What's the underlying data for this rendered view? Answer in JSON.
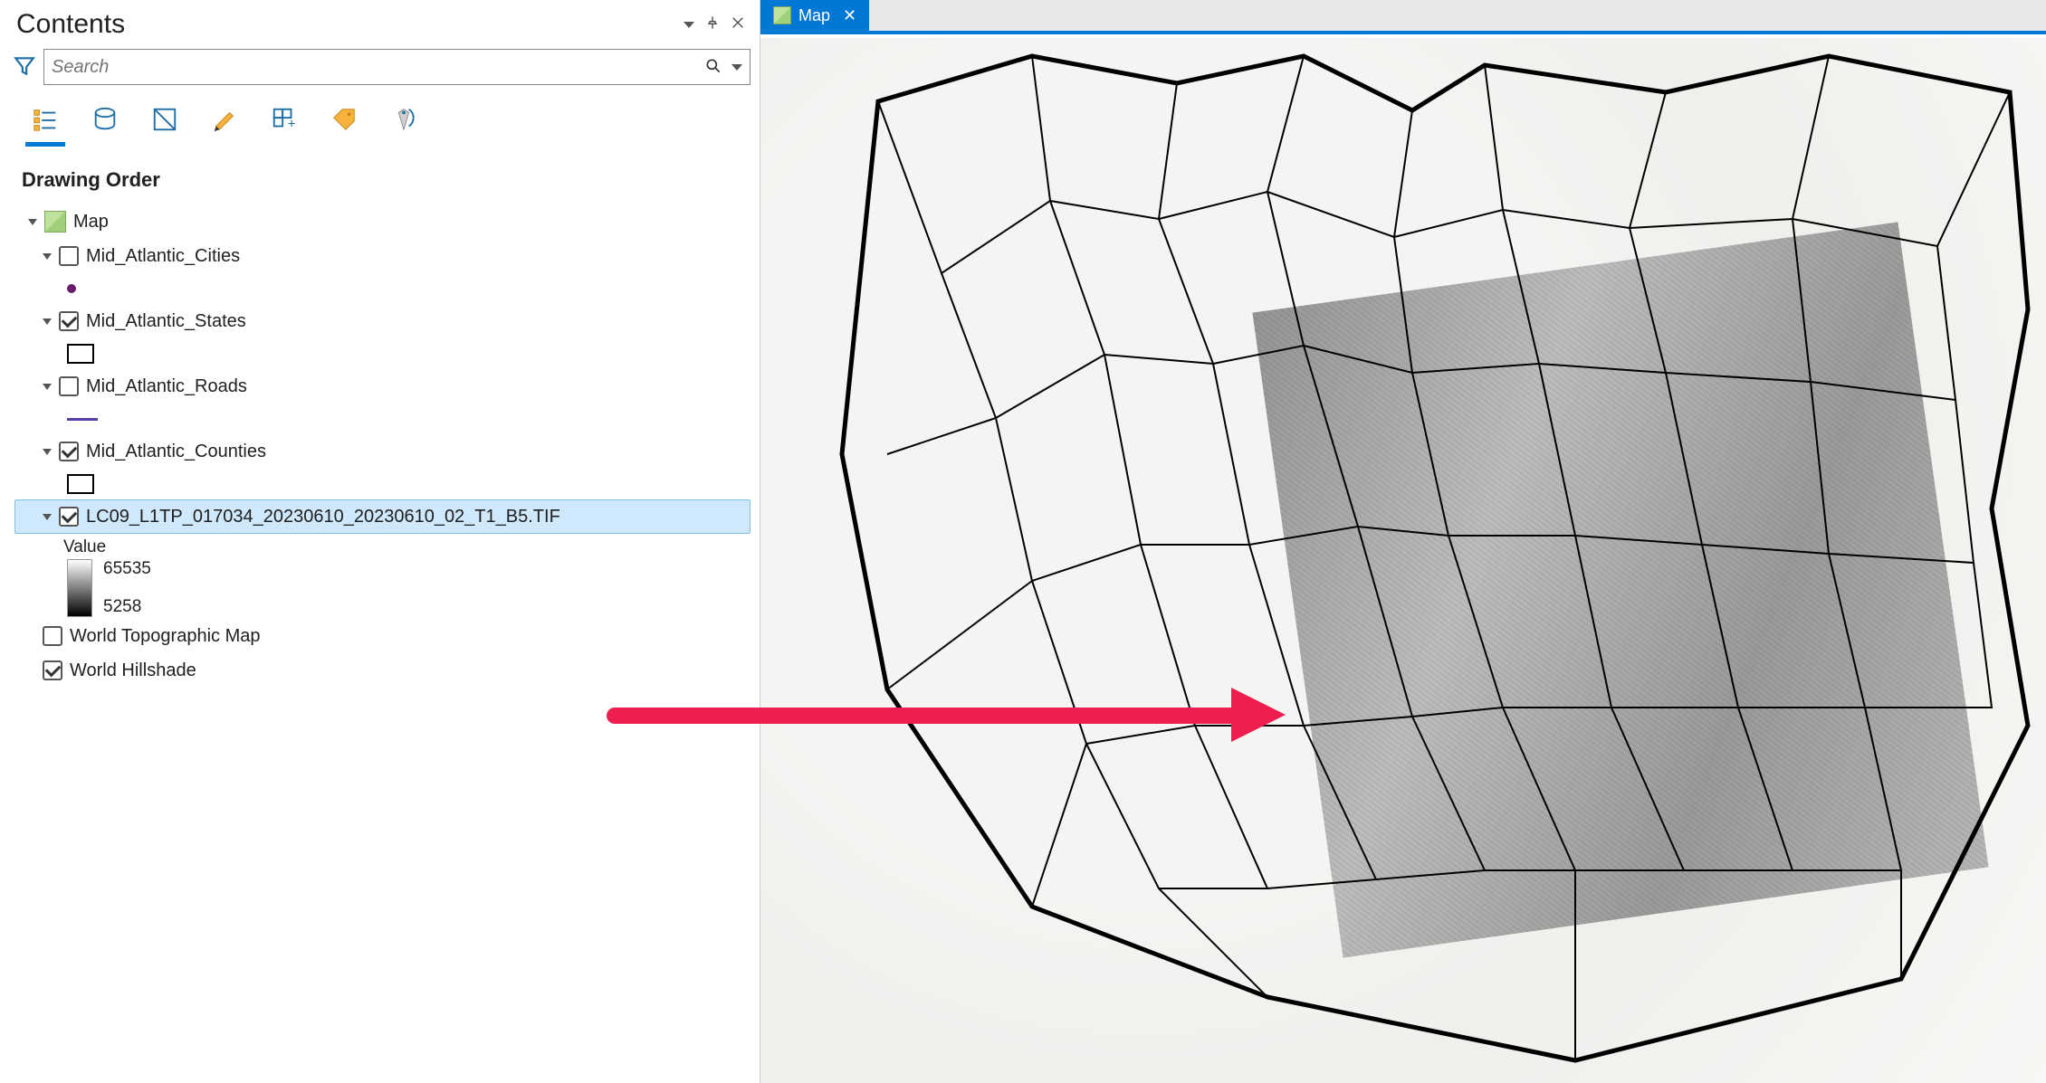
{
  "contents": {
    "title": "Contents",
    "search_placeholder": "Search",
    "section_label": "Drawing Order",
    "map_label": "Map"
  },
  "layers": {
    "cities": {
      "name": "Mid_Atlantic_Cities",
      "checked": false
    },
    "states": {
      "name": "Mid_Atlantic_States",
      "checked": true
    },
    "roads": {
      "name": "Mid_Atlantic_Roads",
      "checked": false
    },
    "counties": {
      "name": "Mid_Atlantic_Counties",
      "checked": true
    },
    "raster": {
      "name": "LC09_L1TP_017034_20230610_20230610_02_T1_B5.TIF",
      "checked": true,
      "value_label": "Value",
      "max": "65535",
      "min": "5258",
      "selected": true
    },
    "topo": {
      "name": "World Topographic Map",
      "checked": false
    },
    "hillshade": {
      "name": "World Hillshade",
      "checked": true
    }
  },
  "view_tab": {
    "label": "Map"
  },
  "colors": {
    "accent": "#0078d4",
    "arrow": "#ef1e50"
  }
}
